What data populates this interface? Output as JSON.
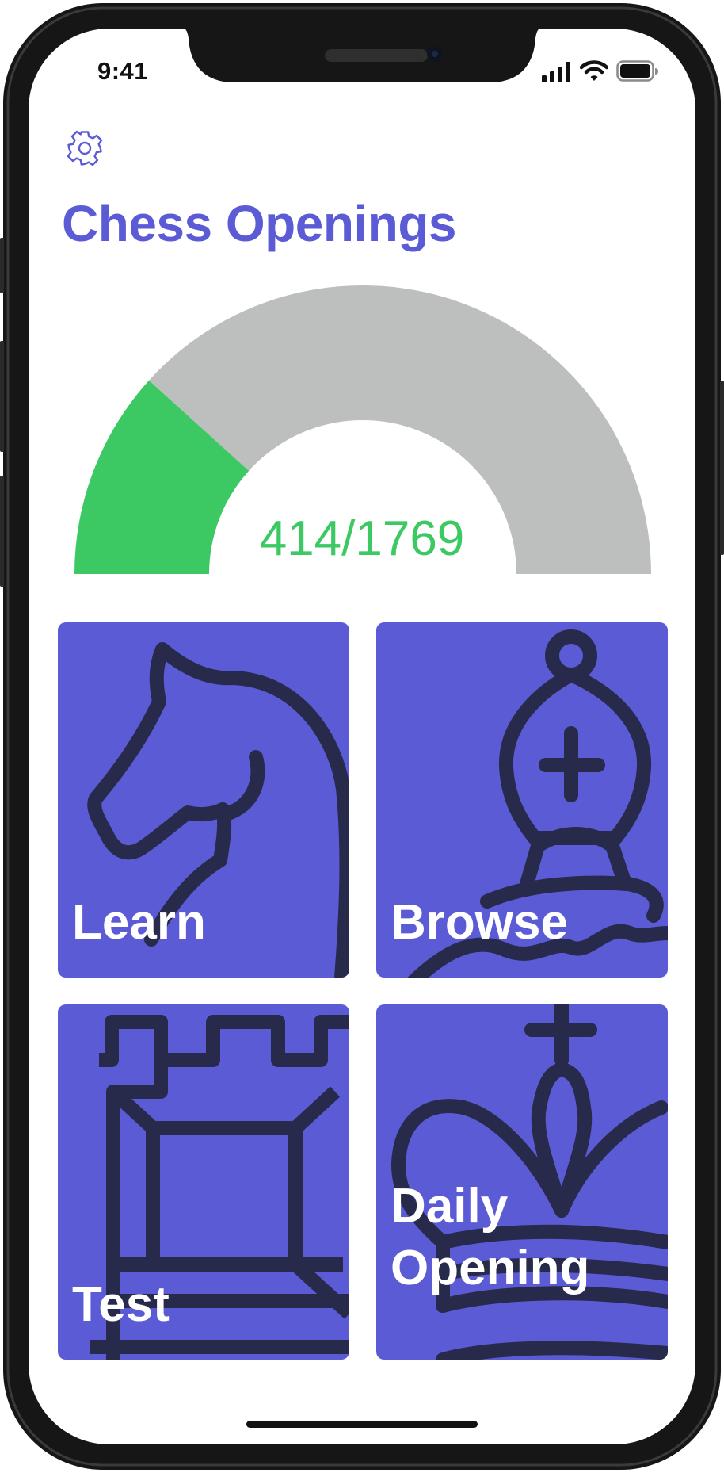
{
  "status_bar": {
    "time": "9:41",
    "icons": [
      "cellular-signal-icon",
      "wifi-icon",
      "battery-icon"
    ]
  },
  "header": {
    "settings_icon": "gear-icon",
    "title": "Chess Openings"
  },
  "progress": {
    "learned": 414,
    "total": 1769,
    "label": "414/1769"
  },
  "tiles": [
    {
      "label": "Learn",
      "icon": "knight-icon"
    },
    {
      "label": "Browse",
      "icon": "bishop-icon"
    },
    {
      "label": "Test",
      "icon": "rook-icon"
    },
    {
      "label": "Daily Opening",
      "label_lines": [
        "Daily",
        "Opening"
      ],
      "icon": "king-icon"
    }
  ],
  "colors": {
    "accent": "#5b5bd6",
    "progress_fill": "#3cc862",
    "progress_track": "#bdbebe",
    "tile_bg": "#5b5bd6",
    "tile_art": "#272a4a",
    "frame": "#161616"
  }
}
